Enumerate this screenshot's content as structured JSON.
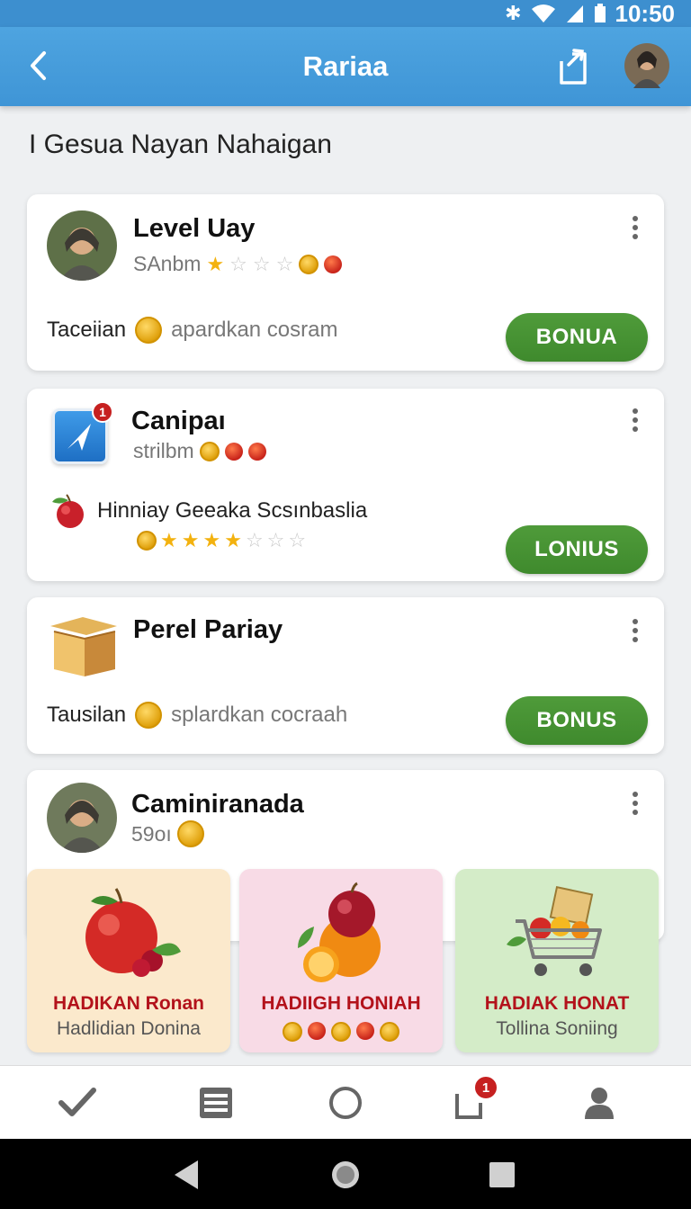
{
  "status_bar": {
    "time": "10:50"
  },
  "app_bar": {
    "title": "Rariaa"
  },
  "section_title": "I Gesua Nayan Nahaigan",
  "cards": [
    {
      "title": "Level Uay",
      "subtitle": "SAnbm",
      "row_label": "Taceiian",
      "row_text": "apardkan cosram",
      "button": "BONUA"
    },
    {
      "title": "Canipaı",
      "subtitle": "strilbm",
      "row_label": "Hinniay Geeaka Scsınbaslia",
      "button": "LONIUS",
      "badge": "1"
    },
    {
      "title": "Perel Pariay",
      "row_label": "Tausilan",
      "row_text": "splardkan cocraah",
      "button": "BONUS"
    },
    {
      "title": "Caminiranada",
      "subtitle": "59oı"
    }
  ],
  "rewards": [
    {
      "name": "HADIKAN Ronan",
      "subtitle": "Hadlidian Donina",
      "bg": "#fbe9cc"
    },
    {
      "name": "HADIIGH HONIAH",
      "subtitle": "",
      "bg": "#f8dbe6"
    },
    {
      "name": "HADIAK HONAT",
      "subtitle": "Tollina Soniing",
      "bg": "#d4ecc8"
    }
  ],
  "bottom_nav": {
    "items": [
      "check-icon",
      "list-icon",
      "circle-icon",
      "share-icon",
      "person-icon"
    ],
    "share_badge": "1"
  },
  "colors": {
    "primary": "#3f95d6",
    "button_green": "#4a9636",
    "reward_text": "#b3121b"
  }
}
